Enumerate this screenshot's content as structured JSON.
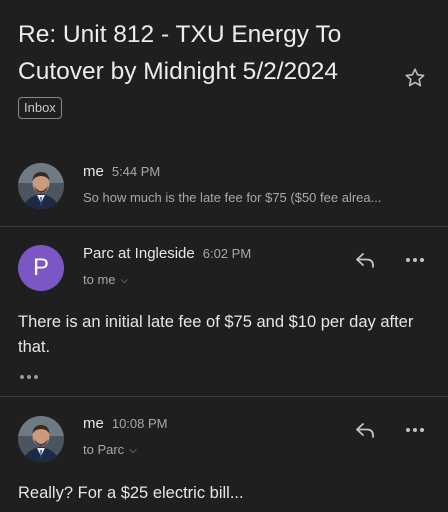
{
  "thread": {
    "subject": "Re: Unit 812 - TXU Energy To Cutover by Midnight 5/2/2024",
    "label": "Inbox"
  },
  "messages": [
    {
      "sender": "me",
      "time": "5:44 PM",
      "snippet": "So how much is the late fee for $75 ($50 fee alrea...",
      "avatar": "photo"
    },
    {
      "sender": "Parc at Ingleside",
      "time": "6:02 PM",
      "recipient": "to me",
      "avatar_letter": "P",
      "body": "There is an initial late fee of $75 and $10 per day after that."
    },
    {
      "sender": "me",
      "time": "10:08 PM",
      "recipient": "to Parc",
      "avatar": "photo",
      "body": "Really? For a $25 electric bill..."
    }
  ],
  "icons": {
    "star": "star-outline-icon",
    "reply": "reply-icon",
    "more": "more-horizontal-icon",
    "caret": "chevron-down-icon"
  },
  "colors": {
    "background": "#1f1f1f",
    "avatar_purple": "#7b57c6",
    "divider": "#3c3c3c"
  }
}
